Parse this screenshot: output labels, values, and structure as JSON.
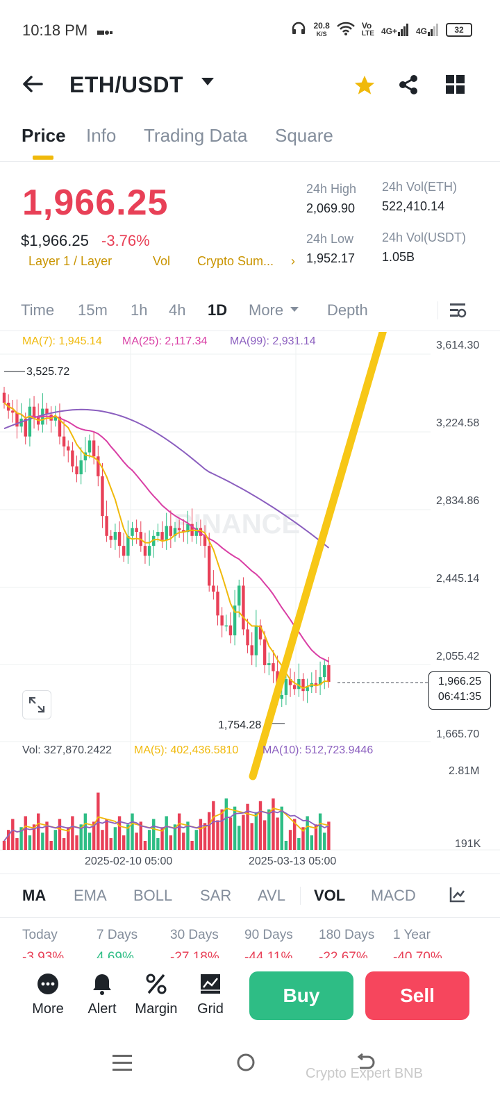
{
  "status": {
    "time": "10:18 PM",
    "speed": "20.8",
    "speed_unit": "K/S",
    "net1": "Vo",
    "net1b": "LTE",
    "net2": "4G+",
    "net3": "4G",
    "battery": "32"
  },
  "header": {
    "pair": "ETH/USDT"
  },
  "tabs": [
    "Price",
    "Info",
    "Trading Data",
    "Square"
  ],
  "ticker": {
    "last_price": "1,966.25",
    "usd_price": "$1,966.25",
    "change_pct": "-3.76%",
    "tags": [
      "Layer 1 / Layer",
      "Vol",
      "Crypto Sum..."
    ],
    "high_label": "24h High",
    "high": "2,069.90",
    "low_label": "24h Low",
    "low": "1,952.17",
    "vol_eth_label": "24h Vol(ETH)",
    "vol_eth": "522,410.14",
    "vol_usdt_label": "24h Vol(USDT)",
    "vol_usdt": "1.05B"
  },
  "intervals": [
    "Time",
    "15m",
    "1h",
    "4h",
    "1D",
    "More",
    "Depth"
  ],
  "ma": {
    "ma7": "MA(7): 1,945.14",
    "ma25": "MA(25): 2,117.34",
    "ma99": "MA(99): 2,931.14"
  },
  "colors": {
    "up": "#2ebd85",
    "down": "#e84057",
    "ma7": "#f0b90b",
    "ma25": "#d93fa5",
    "ma99": "#8b5fbf",
    "accent": "#f0b90b"
  },
  "chart": {
    "y_ticks": [
      "3,614.30",
      "3,224.58",
      "2,834.86",
      "2,445.14",
      "2,055.42",
      "1,665.70"
    ],
    "high_marker": "3,525.72",
    "low_marker": "1,754.28",
    "current_price": "1,966.25",
    "countdown": "06:41:35",
    "watermark": "BINANCE",
    "vol_label": "Vol: 327,870.2422",
    "vol_ma5": "MA(5): 402,436.5810",
    "vol_ma10": "MA(10): 512,723.9446",
    "vol_ticks": [
      "2.81M",
      "191K"
    ],
    "dates": [
      "2025-02-10 05:00",
      "2025-03-13 05:00"
    ]
  },
  "indicators": [
    "MA",
    "EMA",
    "BOLL",
    "SAR",
    "AVL",
    "VOL",
    "MACD"
  ],
  "performance": [
    {
      "label": "Today",
      "value": "-3.93%"
    },
    {
      "label": "7 Days",
      "value": "4.69%"
    },
    {
      "label": "30 Days",
      "value": "-27.18%"
    },
    {
      "label": "90 Days",
      "value": "-44.11%"
    },
    {
      "label": "180 Days",
      "value": "-22.67%"
    },
    {
      "label": "1 Year",
      "value": "-40.70%"
    }
  ],
  "actions": {
    "more": "More",
    "alert": "Alert",
    "margin": "Margin",
    "grid": "Grid",
    "buy": "Buy",
    "sell": "Sell"
  },
  "watermark_credit": "Crypto Expert BNB"
}
